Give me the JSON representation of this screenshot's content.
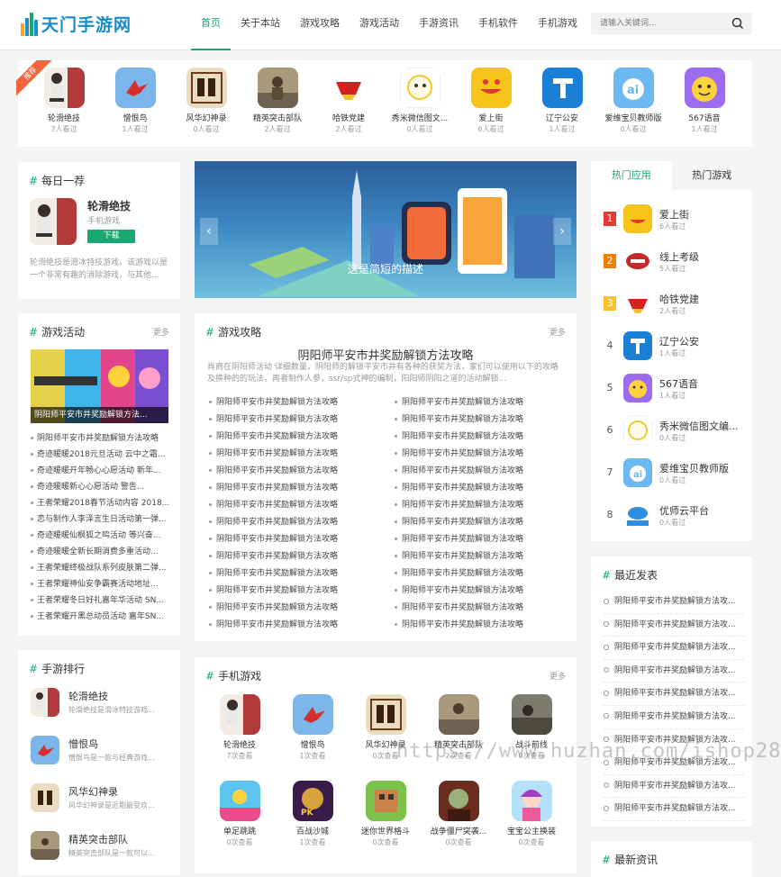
{
  "site": {
    "logo_text": "天门手游网"
  },
  "nav": [
    {
      "label": "首页",
      "active": true
    },
    {
      "label": "关于本站"
    },
    {
      "label": "游戏攻略"
    },
    {
      "label": "游戏活动"
    },
    {
      "label": "手游资讯"
    },
    {
      "label": "手机软件"
    },
    {
      "label": "手机游戏"
    }
  ],
  "search": {
    "placeholder": "请输入关键词..."
  },
  "featured_apps": {
    "ribbon": "推荐",
    "items": [
      {
        "name": "轮滑绝技",
        "count": "7人看过",
        "icon": "skater-icon"
      },
      {
        "name": "憎恨鸟",
        "count": "1人看过",
        "icon": "red-bird-icon"
      },
      {
        "name": "风华幻神录",
        "count": "0人看过",
        "icon": "fantasy-icon"
      },
      {
        "name": "精英突击部队",
        "count": "2人看过",
        "icon": "soldier-icon"
      },
      {
        "name": "哈铁党建",
        "count": "2人看过",
        "icon": "party-icon"
      },
      {
        "name": "秀米微信图文...",
        "count": "0人看过",
        "icon": "xiumi-icon"
      },
      {
        "name": "爱上街",
        "count": "6人看过",
        "icon": "shopping-icon"
      },
      {
        "name": "辽宁公安",
        "count": "1人看过",
        "icon": "police-icon"
      },
      {
        "name": "爱维宝贝教师版",
        "count": "0人看过",
        "icon": "ai-icon"
      },
      {
        "name": "567语音",
        "count": "1人看过",
        "icon": "voice-icon"
      }
    ]
  },
  "daily": {
    "title": "每日一荐",
    "name": "轮滑绝技",
    "category": "手机游戏",
    "download": "下载",
    "desc": "轮滑绝技是滑冰特技游戏，该游戏以是一个非常有趣的消除游戏，与其他..."
  },
  "banner": {
    "caption": "这是简短的描述",
    "prev": "‹",
    "next": "›"
  },
  "hot": {
    "tab_apps": "热门应用",
    "tab_games": "热门游戏",
    "items": [
      {
        "rank": "1",
        "name": "爱上街",
        "count": "6人看过"
      },
      {
        "rank": "2",
        "name": "线上考级",
        "count": "5人看过"
      },
      {
        "rank": "3",
        "name": "哈铁党建",
        "count": "2人看过"
      },
      {
        "rank": "4",
        "name": "辽宁公安",
        "count": "1人看过"
      },
      {
        "rank": "5",
        "name": "567语音",
        "count": "1人看过"
      },
      {
        "rank": "6",
        "name": "秀米微信图文编...",
        "count": "0人看过"
      },
      {
        "rank": "7",
        "name": "爱维宝贝教师版",
        "count": "0人看过"
      },
      {
        "rank": "8",
        "name": "优师云平台",
        "count": "0人看过"
      }
    ]
  },
  "events": {
    "title": "游戏活动",
    "more": "更多",
    "featured_caption": "阴阳师平安市井奖励解锁方法...",
    "items": [
      "阴阳师平安市井奖励解锁方法攻略",
      "奇迹暖暖2018元旦活动 云中之霜...",
      "奇迹暖暖开年畅心心愿活动 新年...",
      "奇迹暖暖新心心愿活动 警告...",
      "王者荣耀2018春节活动内容 2018...",
      "恋与制作人李泽言生日活动第一弹...",
      "奇迹暖暖仙枫狐之鸣活动 等兴奋...",
      "奇迹暖暖全新长期消费多重活动...",
      "王者荣耀终极战队系列皮肤第二弹...",
      "王者荣耀神仙安争霸赛活动地址...",
      "王者荣耀冬日好礼嘉年华活动 SN...",
      "王者荣耀开黑总动员活动 嘉年SN..."
    ]
  },
  "guide": {
    "title": "游戏攻略",
    "more": "更多",
    "headline": "阴阳师平安市井奖励解锁方法攻略",
    "summary": "肖商在阴阳师活动 详细数量，阴阳师的解锁平安市井有各种的获奖方法，家们可以使用以下的攻略及换种的的玩法，再者制作人参，ssr/sp式神的编制，阳阳师阴阳之道的活动解锁...",
    "left": [
      "阴阳师平安市井奖励解锁方法攻略",
      "阴阳师平安市井奖励解锁方法攻略",
      "阴阳师平安市井奖励解锁方法攻略",
      "阴阳师平安市井奖励解锁方法攻略",
      "阴阳师平安市井奖励解锁方法攻略",
      "阴阳师平安市井奖励解锁方法攻略",
      "阴阳师平安市井奖励解锁方法攻略",
      "阴阳师平安市井奖励解锁方法攻略",
      "阴阳师平安市井奖励解锁方法攻略",
      "阴阳师平安市井奖励解锁方法攻略",
      "阴阳师平安市井奖励解锁方法攻略",
      "阴阳师平安市井奖励解锁方法攻略",
      "阴阳师平安市井奖励解锁方法攻略",
      "阴阳师平安市井奖励解锁方法攻略"
    ],
    "right": [
      "阴阳师平安市井奖励解锁方法攻略",
      "阴阳师平安市井奖励解锁方法攻略",
      "阴阳师平安市井奖励解锁方法攻略",
      "阴阳师平安市井奖励解锁方法攻略",
      "阴阳师平安市井奖励解锁方法攻略",
      "阴阳师平安市井奖励解锁方法攻略",
      "阴阳师平安市井奖励解锁方法攻略",
      "阴阳师平安市井奖励解锁方法攻略",
      "阴阳师平安市井奖励解锁方法攻略",
      "阴阳师平安市井奖励解锁方法攻略",
      "阴阳师平安市井奖励解锁方法攻略",
      "阴阳师平安市井奖励解锁方法攻略",
      "阴阳师平安市井奖励解锁方法攻略",
      "阴阳师平安市井奖励解锁方法攻略"
    ]
  },
  "recent": {
    "title": "最近发表",
    "items": [
      "阴阳师平安市井奖励解锁方法攻...",
      "阴阳师平安市井奖励解锁方法攻...",
      "阴阳师平安市井奖励解锁方法攻...",
      "阴阳师平安市井奖励解锁方法攻...",
      "阴阳师平安市井奖励解锁方法攻...",
      "阴阳师平安市井奖励解锁方法攻...",
      "阴阳师平安市井奖励解锁方法攻...",
      "阴阳师平安市井奖励解锁方法攻...",
      "阴阳师平安市井奖励解锁方法攻...",
      "阴阳师平安市井奖励解锁方法攻..."
    ]
  },
  "news": {
    "title": "最新资讯"
  },
  "rank": {
    "title": "手游排行",
    "items": [
      {
        "name": "轮滑绝技",
        "desc": "轮滑绝技是滑冰特技游戏..."
      },
      {
        "name": "憎恨鸟",
        "desc": "憎恨鸟是一款与经典游戏..."
      },
      {
        "name": "风华幻神录",
        "desc": "风华幻神录是近期最受欢..."
      },
      {
        "name": "精英突击部队",
        "desc": "精英突击部队是一款可以..."
      }
    ]
  },
  "mobile_games": {
    "title": "手机游戏",
    "more": "更多",
    "items": [
      {
        "name": "轮滑绝技",
        "count": "7次查看"
      },
      {
        "name": "憎恨鸟",
        "count": "1次查看"
      },
      {
        "name": "风华幻神录",
        "count": "0次查看"
      },
      {
        "name": "精英突击部队",
        "count": "2次查看"
      },
      {
        "name": "战斗前线",
        "count": "0次查看"
      },
      {
        "name": "单足跳跳",
        "count": "0次查看"
      },
      {
        "name": "百战沙城",
        "count": "1次查看"
      },
      {
        "name": "迷你世界格斗",
        "count": "0次查看"
      },
      {
        "name": "战争僵尸突袭...",
        "count": "0次查看"
      },
      {
        "name": "宝宝公主换装",
        "count": "0次查看"
      }
    ]
  },
  "watermark": "https://www.huzhan.com/ishop289"
}
